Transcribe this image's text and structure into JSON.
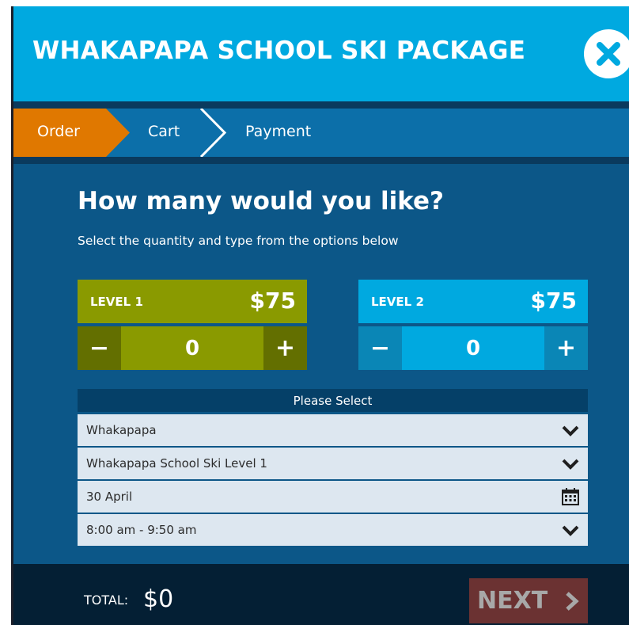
{
  "header": {
    "title": "WHAKAPAPA SCHOOL SKI PACKAGE"
  },
  "steps": [
    {
      "label": "Order",
      "active": true
    },
    {
      "label": "Cart",
      "active": false
    },
    {
      "label": "Payment",
      "active": false
    }
  ],
  "main": {
    "title": "How many would you like?",
    "subtitle": "Select the quantity and type from the options below"
  },
  "products": [
    {
      "level": "LEVEL 1",
      "price": "$75",
      "quantity": "0",
      "minus": "−",
      "plus": "+",
      "color": "#8a9a00"
    },
    {
      "level": "LEVEL 2",
      "price": "$75",
      "quantity": "0",
      "minus": "−",
      "plus": "+",
      "color": "#00a9e0"
    }
  ],
  "selection": {
    "header": "Please Select",
    "location": "Whakapapa",
    "package": "Whakapapa School Ski Level 1",
    "date": "30 April",
    "time": "8:00 am - 9:50 am"
  },
  "footer": {
    "total_label": "TOTAL:",
    "total_value": "$0",
    "next_label": "NEXT"
  },
  "colors": {
    "accent": "#00a9e0",
    "active_step": "#e07800",
    "panel": "#0c5788",
    "level1": "#8a9a00",
    "next_disabled": "#6b3232"
  },
  "icons": [
    "close-icon",
    "chevron-down-icon",
    "calendar-icon",
    "chevron-right-icon"
  ]
}
